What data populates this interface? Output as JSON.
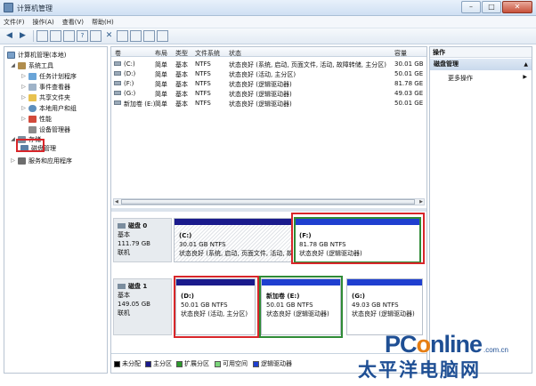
{
  "window": {
    "title": "计算机管理",
    "minimize": "–",
    "maximize": "□",
    "close": "✕"
  },
  "menu": [
    "文件(F)",
    "操作(A)",
    "查看(V)",
    "帮助(H)"
  ],
  "toolbar": {
    "back": "◀",
    "forward": "▶",
    "delete": "✕",
    "help": "?"
  },
  "tree": {
    "root": "计算机管理(本地)",
    "system_tools": "系统工具",
    "task_scheduler": "任务计划程序",
    "event_viewer": "事件查看器",
    "shared_folders": "共享文件夹",
    "local_users": "本地用户和组",
    "performance": "性能",
    "device_manager": "设备管理器",
    "storage": "存储",
    "disk_management": "磁盘管理",
    "services": "服务和应用程序"
  },
  "volumes": {
    "headers": {
      "volume": "卷",
      "layout": "布局",
      "type": "类型",
      "fs": "文件系统",
      "status": "状态",
      "capacity": "容量"
    },
    "rows": [
      {
        "volume": "(C:)",
        "layout": "简单",
        "type": "基本",
        "fs": "NTFS",
        "status": "状态良好 (系统, 启动, 页面文件, 活动, 故障转储, 主分区)",
        "capacity": "30.01 GB"
      },
      {
        "volume": "(D:)",
        "layout": "简单",
        "type": "基本",
        "fs": "NTFS",
        "status": "状态良好 (活动, 主分区)",
        "capacity": "50.01 GE"
      },
      {
        "volume": "(F:)",
        "layout": "简单",
        "type": "基本",
        "fs": "NTFS",
        "status": "状态良好 (逻辑驱动器)",
        "capacity": "81.78 GE"
      },
      {
        "volume": "(G:)",
        "layout": "简单",
        "type": "基本",
        "fs": "NTFS",
        "status": "状态良好 (逻辑驱动器)",
        "capacity": "49.03 GE"
      },
      {
        "volume": "新加卷 (E:)",
        "layout": "简单",
        "type": "基本",
        "fs": "NTFS",
        "status": "状态良好 (逻辑驱动器)",
        "capacity": "50.01 GE"
      }
    ]
  },
  "disks": [
    {
      "name": "磁盘 0",
      "kind": "基本",
      "size": "111.79 GB",
      "state": "联机",
      "partitions": [
        {
          "letter": "(C:)",
          "size": "30.01 GB NTFS",
          "status": "状态良好 (系统, 启动, 页面文件, 活动, 故"
        },
        {
          "letter": "(F:)",
          "size": "81.78 GB NTFS",
          "status": "状态良好 (逻辑驱动器)"
        }
      ]
    },
    {
      "name": "磁盘 1",
      "kind": "基本",
      "size": "149.05 GB",
      "state": "联机",
      "partitions": [
        {
          "letter": "(D:)",
          "size": "50.01 GB NTFS",
          "status": "状态良好 (活动, 主分区)"
        },
        {
          "letter": "新加卷 (E:)",
          "size": "50.01 GB NTFS",
          "status": "状态良好 (逻辑驱动器)"
        },
        {
          "letter": "(G:)",
          "size": "49.03 GB NTFS",
          "status": "状态良好 (逻辑驱动器)"
        }
      ]
    }
  ],
  "legend": [
    {
      "label": "未分配",
      "color": "#000000"
    },
    {
      "label": "主分区",
      "color": "#1a1a8c"
    },
    {
      "label": "扩展分区",
      "color": "#2d9a2d"
    },
    {
      "label": "可用空间",
      "color": "#7bd67b"
    },
    {
      "label": "逻辑驱动器",
      "color": "#1f3fd0"
    }
  ],
  "actions": {
    "header": "操作",
    "section": "磁盘管理",
    "more": "更多操作"
  },
  "watermark": {
    "logo_a": "PC",
    "logo_b": "o",
    "logo_c": "nline",
    "domain": ".com.cn",
    "cn": "太平洋电脑网"
  }
}
